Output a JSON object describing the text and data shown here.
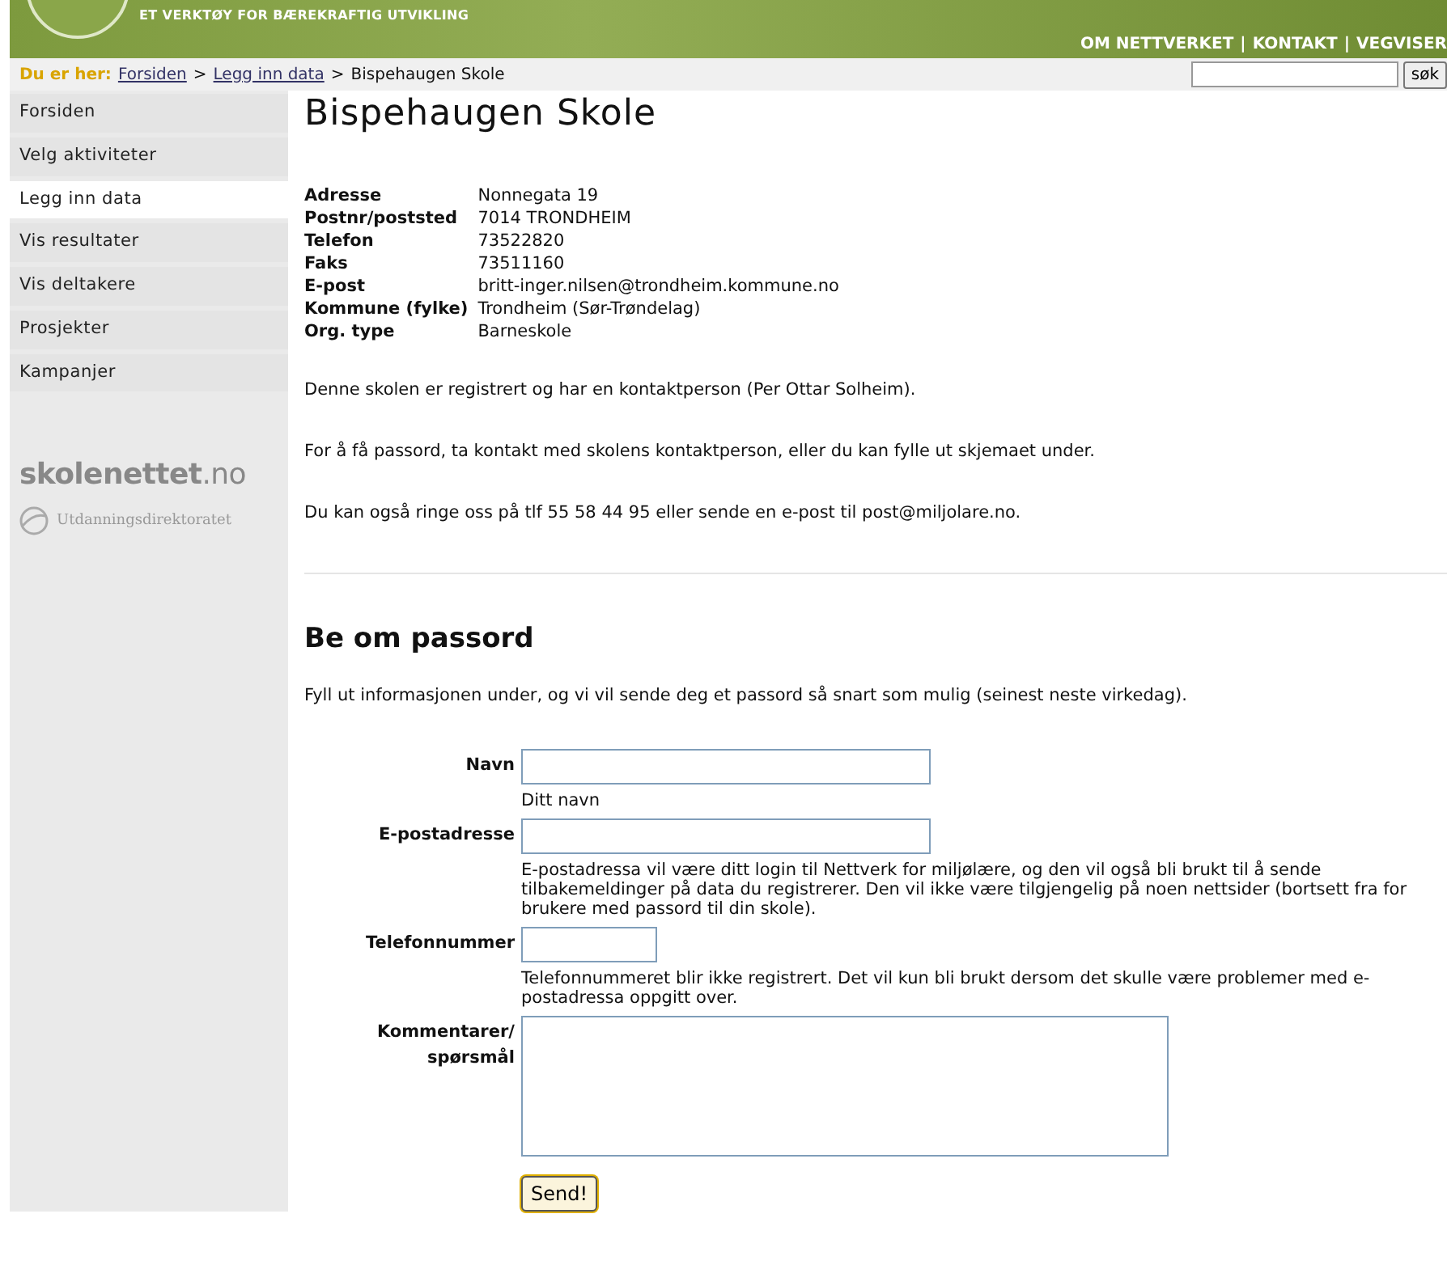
{
  "header": {
    "tagline": "ET VERKTØY FOR BÆREKRAFTIG UTVIKLING",
    "links": [
      "OM NETTVERKET",
      "KONTAKT",
      "VEGVISER"
    ],
    "separator": "|"
  },
  "breadcrumb": {
    "label": "Du er her:",
    "links": [
      "Forsiden",
      "Legg inn data"
    ],
    "separator": ">",
    "current": "Bispehaugen Skole"
  },
  "search": {
    "button": "søk"
  },
  "sidebar": {
    "items": [
      {
        "label": "Forsiden",
        "selected": false
      },
      {
        "label": "Velg aktiviteter",
        "selected": false
      },
      {
        "label": "Legg inn data",
        "selected": true
      },
      {
        "label": "Vis resultater",
        "selected": false
      },
      {
        "label": "Vis deltakere",
        "selected": false
      },
      {
        "label": "Prosjekter",
        "selected": false
      },
      {
        "label": "Kampanjer",
        "selected": false
      }
    ],
    "logo_main": "skolenettet",
    "logo_suffix": ".no",
    "logo_sub": "Utdanningsdirektoratet"
  },
  "title": "Bispehaugen Skole",
  "details": [
    {
      "label": "Adresse",
      "value": "Nonnegata 19"
    },
    {
      "label": "Postnr/poststed",
      "value": "7014 TRONDHEIM"
    },
    {
      "label": "Telefon",
      "value": "73522820"
    },
    {
      "label": "Faks",
      "value": "73511160"
    },
    {
      "label": "E-post",
      "value": "britt-inger.nilsen@trondheim.kommune.no"
    },
    {
      "label": "Kommune (fylke)",
      "value": "Trondheim (Sør-Trøndelag)"
    },
    {
      "label": "Org. type",
      "value": "Barneskole"
    }
  ],
  "paragraphs": [
    "Denne skolen er registrert og har en kontaktperson (Per Ottar Solheim).",
    "For å få passord, ta kontakt med skolens kontaktperson, eller du kan fylle ut skjemaet under.",
    "Du kan også ringe oss på tlf 55 58 44 95 eller sende en e-post til post@miljolare.no."
  ],
  "form": {
    "title": "Be om passord",
    "intro": "Fyll ut informasjonen under, og vi vil sende deg et passord så snart som mulig (seinest neste virkedag).",
    "fields": [
      {
        "kind": "text",
        "label": "Navn",
        "help": "Ditt navn"
      },
      {
        "kind": "text",
        "label": "E-postadresse",
        "help": "E-postadressa vil være ditt login til Nettverk for miljølære, og den vil også bli brukt til å sende tilbakemeldinger på data du registrerer. Den vil ikke være tilgjengelig på noen nettsider (bortsett fra for brukere med passord til din skole)."
      },
      {
        "kind": "text",
        "label": "Telefonnummer",
        "help": "Telefonnummeret blir ikke registrert. Det vil kun bli brukt dersom det skulle være problemer med e-postadressa oppgitt over."
      },
      {
        "kind": "textarea",
        "label": "Kommentarer/ spørsmål"
      }
    ],
    "submit": "Send!"
  }
}
